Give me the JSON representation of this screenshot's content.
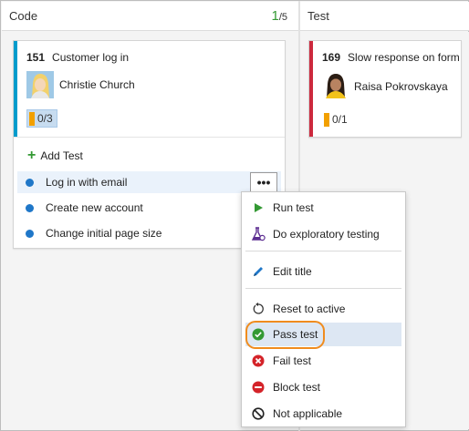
{
  "columns": {
    "code": {
      "title": "Code",
      "wip_current": "1",
      "wip_limit": "/5"
    },
    "test": {
      "title": "Test"
    }
  },
  "cards": {
    "card1": {
      "id": "151",
      "title": "Customer log in",
      "assignee": "Christie Church",
      "progress": "0/3",
      "stripe_color": "#009ccc",
      "add_test_label": "Add Test",
      "tests": [
        "Log in with email",
        "Create new account",
        "Change initial page size"
      ],
      "more_label": "•••"
    },
    "card2": {
      "id": "169",
      "title": "Slow response on form",
      "assignee": "Raisa Pokrovskaya",
      "progress": "0/1",
      "stripe_color": "#cc293d"
    }
  },
  "menu": {
    "items": [
      {
        "label": "Run test",
        "icon": "play-icon"
      },
      {
        "label": "Do exploratory testing",
        "icon": "flask-icon"
      },
      {
        "label": "Edit title",
        "icon": "pencil-icon"
      },
      {
        "label": "Reset to active",
        "icon": "reset-icon"
      },
      {
        "label": "Pass test",
        "icon": "check-circle-icon",
        "highlighted": true
      },
      {
        "label": "Fail test",
        "icon": "x-circle-icon"
      },
      {
        "label": "Block test",
        "icon": "block-icon"
      },
      {
        "label": "Not applicable",
        "icon": "not-applicable-icon"
      }
    ]
  },
  "colors": {
    "accent_green": "#339933",
    "test_dot": "#1f77c8",
    "progress_bar": "#f2a000",
    "highlight_ring": "#f08c1e"
  }
}
